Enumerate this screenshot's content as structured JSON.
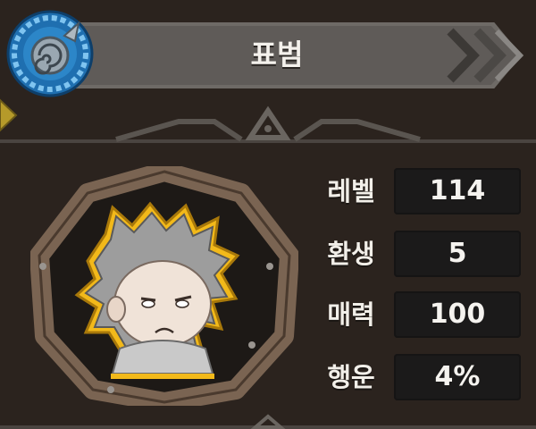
{
  "title": "표범",
  "stats": [
    {
      "label": "레벨",
      "value": "114"
    },
    {
      "label": "환생",
      "value": "5"
    },
    {
      "label": "매력",
      "value": "100"
    },
    {
      "label": "행운",
      "value": "4%"
    }
  ],
  "icons": {
    "emblem": "spiral-emblem-icon",
    "chevrons": "double-chevron-right-icon",
    "portrait": "character-portrait"
  },
  "colors": {
    "background": "#2b231e",
    "banner": "#5f5b58",
    "stat_box": "#1b1a1a",
    "frame_wood": "#7a6452",
    "emblem_blue": "#3a9ad8"
  }
}
